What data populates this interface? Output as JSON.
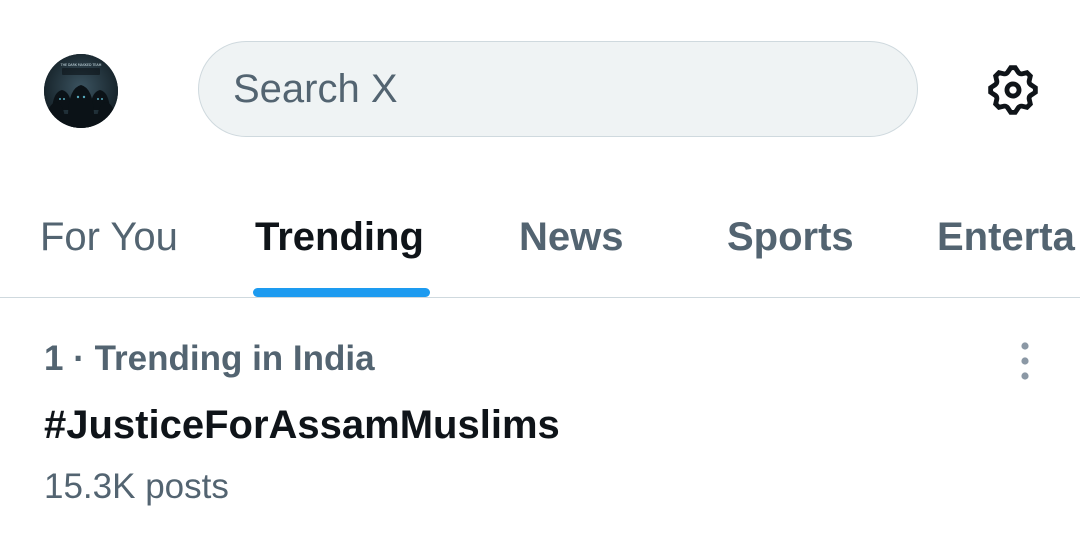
{
  "header": {
    "avatar_text": "THE DARK MASKED TEAM",
    "search_placeholder": "Search X",
    "settings_icon": "gear-icon"
  },
  "tabs": [
    {
      "label": "For You",
      "active": false
    },
    {
      "label": "Trending",
      "active": true
    },
    {
      "label": "News",
      "active": false
    },
    {
      "label": "Sports",
      "active": false
    },
    {
      "label": "Enterta",
      "active": false
    }
  ],
  "trend": {
    "context": "1 · Trending in India",
    "name": "#JusticeForAssamMuslims",
    "posts": "15.3K posts",
    "more_icon": "more-vertical-icon"
  },
  "colors": {
    "accent": "#1d9bf0",
    "primary_text": "#0f1419",
    "secondary_text": "#536471",
    "search_bg": "#eff3f4",
    "divider": "#cfd9de"
  }
}
